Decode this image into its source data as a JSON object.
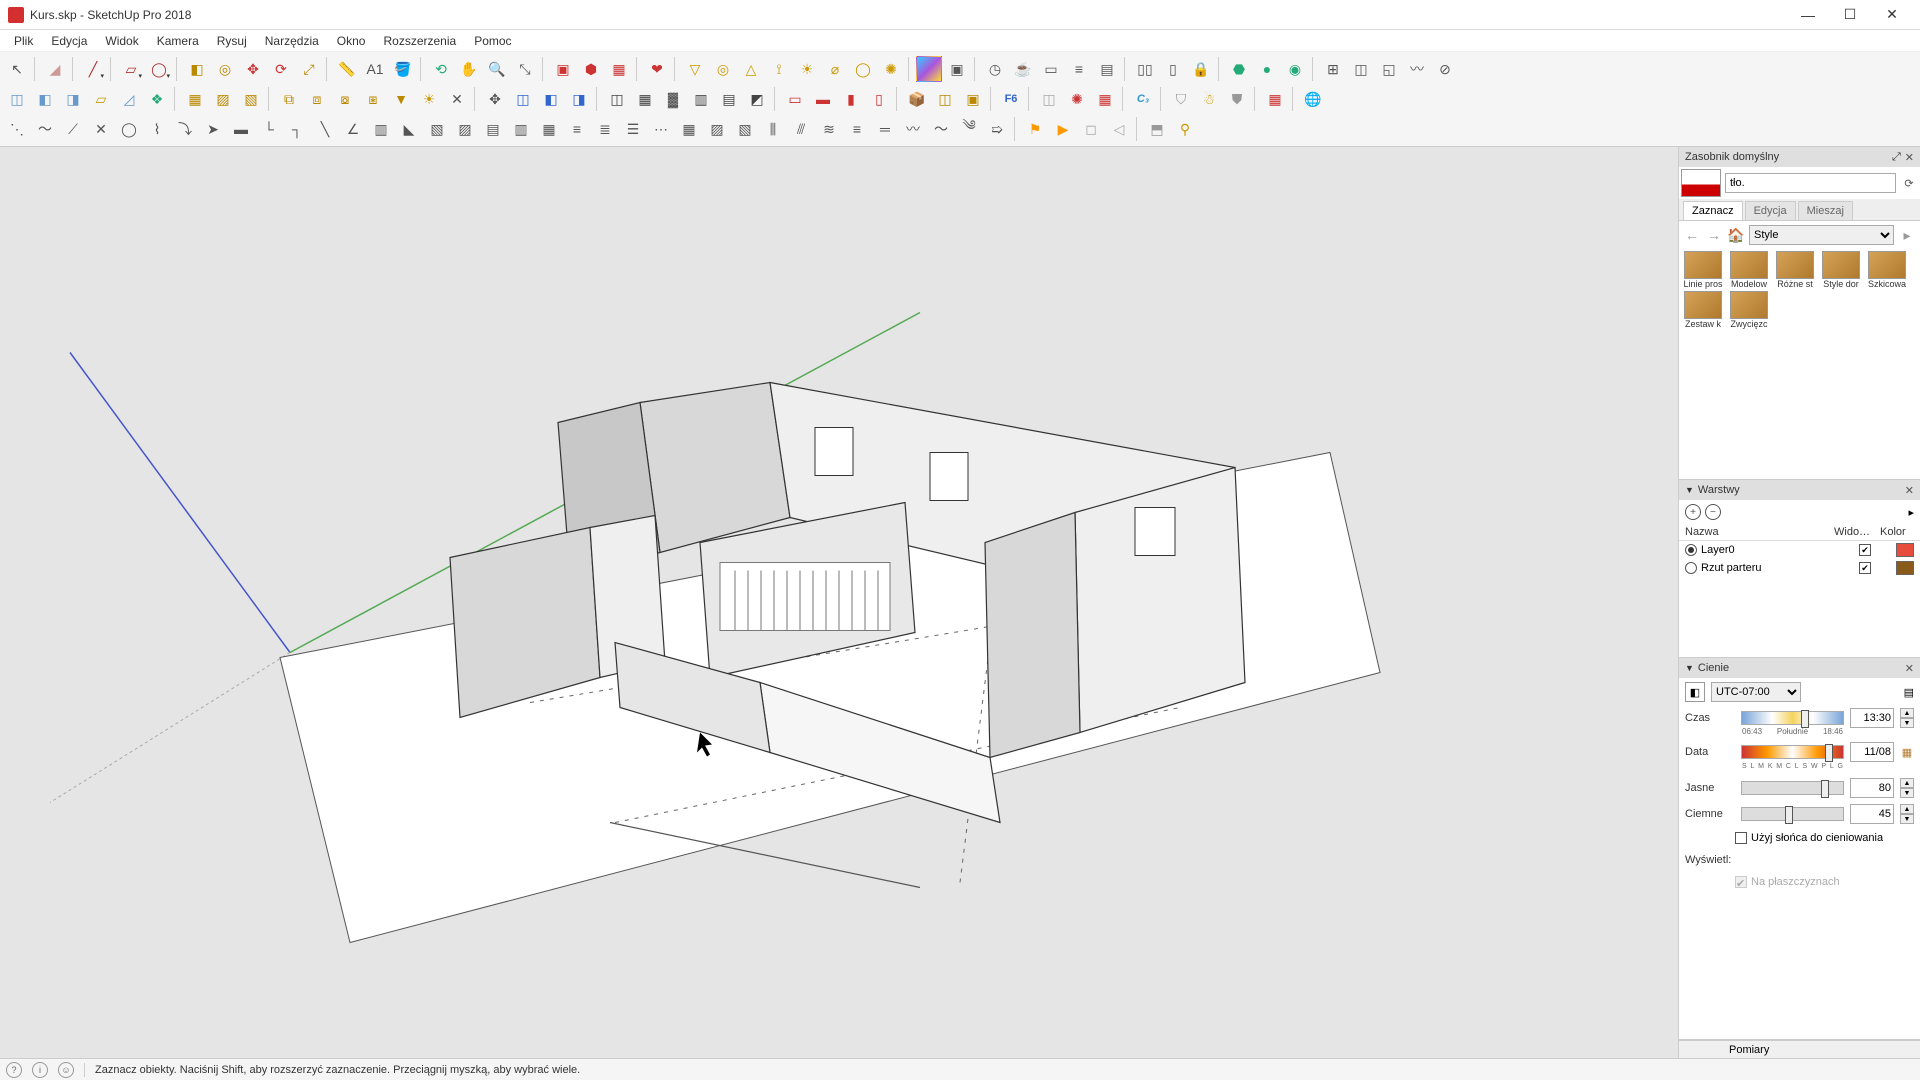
{
  "app": {
    "title": "Kurs.skp - SketchUp Pro 2018"
  },
  "menus": [
    "Plik",
    "Edycja",
    "Widok",
    "Kamera",
    "Rysuj",
    "Narzędzia",
    "Okno",
    "Rozszerzenia",
    "Pomoc"
  ],
  "panels": {
    "tray_title": "Zasobnik domyślny",
    "style_name_field": "tło.",
    "tabs": {
      "select": "Zaznacz",
      "edit": "Edycja",
      "mix": "Mieszaj"
    },
    "style_select": "Style",
    "styles": [
      "Linie pros",
      "Modelow",
      "Różne st",
      "Style dor",
      "Szkicowa",
      "Zestaw k",
      "Zwycięzc"
    ],
    "layers_title": "Warstwy",
    "layers_headers": {
      "name": "Nazwa",
      "visible": "Wido…",
      "color": "Kolor"
    },
    "layers": [
      {
        "name": "Layer0",
        "selected": true,
        "visible": true,
        "color": "#e74c3c"
      },
      {
        "name": "Rzut parteru",
        "selected": false,
        "visible": true,
        "color": "#8a5a1b"
      }
    ],
    "shadows_title": "Cienie",
    "shadows": {
      "timezone": "UTC-07:00",
      "time_label": "Czas",
      "time_value": "13:30",
      "time_slider_marks": [
        "06:43",
        "Południe",
        "18:46"
      ],
      "date_label": "Data",
      "date_value": "11/08",
      "date_slider_marks": [
        "S",
        "L",
        "M",
        "K",
        "M",
        "C",
        "L",
        "S",
        "W",
        "P",
        "L",
        "G"
      ],
      "light_label": "Jasne",
      "light_value": "80",
      "dark_label": "Ciemne",
      "dark_value": "45",
      "use_sun_label": "Użyj słońca do cieniowania",
      "display_label": "Wyświetl:",
      "on_faces_label": "Na płaszczyznach"
    },
    "pomiary": "Pomiary"
  },
  "status": {
    "hint": "Zaznacz obiekty. Naciśnij Shift, aby rozszerzyć zaznaczenie. Przeciągnij myszką, aby wybrać wiele."
  }
}
